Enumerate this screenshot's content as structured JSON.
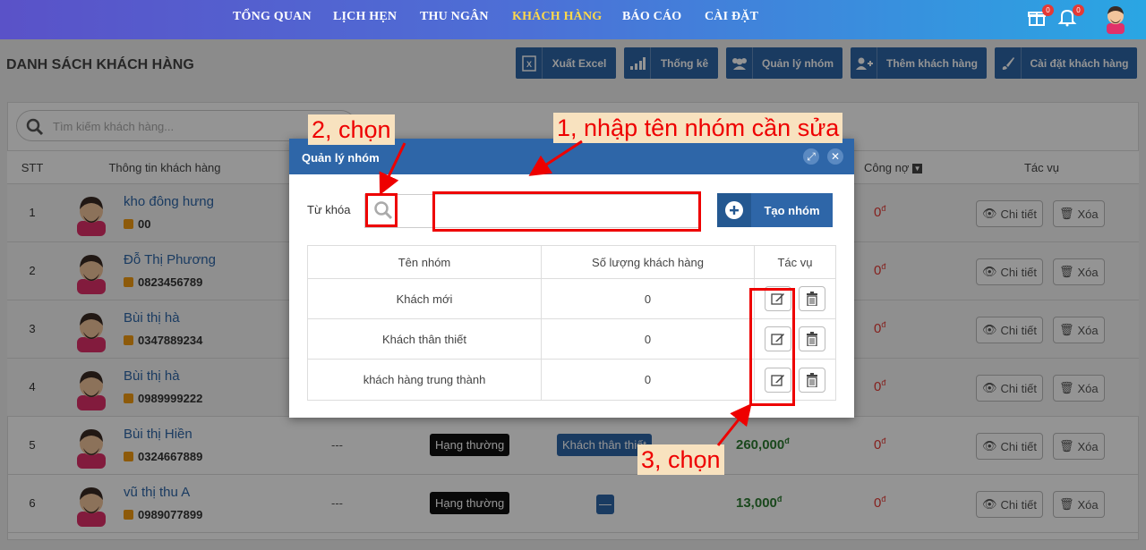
{
  "nav": {
    "items": [
      "TỔNG QUAN",
      "LỊCH HẸN",
      "THU NGÂN",
      "KHÁCH HÀNG",
      "BÁO CÁO",
      "CÀI ĐẶT"
    ],
    "gift_badge": "0",
    "bell_badge": "0"
  },
  "header": {
    "title": "DANH SÁCH KHÁCH HÀNG",
    "buttons": [
      "Xuất Excel",
      "Thống kê",
      "Quản lý nhóm",
      "Thêm khách hàng",
      "Cài đặt khách hàng"
    ]
  },
  "search": {
    "placeholder": "Tìm kiếm khách hàng..."
  },
  "table": {
    "headers": [
      "STT",
      "Thông tin khách hàng",
      "Công nợ",
      "Tác vụ"
    ],
    "detail_label": "Chi tiết",
    "delete_label": "Xóa",
    "rows": [
      {
        "stt": "1",
        "name": "kho đông hưng",
        "phone": "00",
        "debt": "0",
        "debt_unit": "đ"
      },
      {
        "stt": "2",
        "name": "Đỗ Thị Phương",
        "phone": "0823456789",
        "debt": "0",
        "debt_unit": "đ"
      },
      {
        "stt": "3",
        "name": "Bùi thị hà",
        "phone": "0347889234",
        "debt": "0",
        "debt_unit": "đ"
      },
      {
        "stt": "4",
        "name": "Bùi thị hà",
        "phone": "0989999222",
        "debt": "0",
        "debt_unit": "đ"
      },
      {
        "stt": "5",
        "name": "Bùi thị Hiền",
        "phone": "0324667889",
        "debt": "0",
        "debt_unit": "đ",
        "extra": "---",
        "rank": "Hạng thường",
        "group": "Khách thân thiết",
        "spent": "260,000",
        "spent_unit": "đ"
      },
      {
        "stt": "6",
        "name": "vũ thị thu A",
        "phone": "0989077899",
        "debt": "0",
        "debt_unit": "đ",
        "extra": "---",
        "rank": "Hạng thường",
        "group": "—",
        "spent": "13,000",
        "spent_unit": "đ"
      }
    ]
  },
  "modal": {
    "title": "Quản lý nhóm",
    "keyword_label": "Từ khóa",
    "keyword_value": "",
    "create_label": "Tạo nhóm",
    "columns": [
      "Tên nhóm",
      "Số lượng khách hàng",
      "Tác vụ"
    ],
    "groups": [
      {
        "name": "Khách mới",
        "count": "0"
      },
      {
        "name": "Khách thân thiết",
        "count": "0"
      },
      {
        "name": "khách hàng trung thành",
        "count": "0"
      }
    ]
  },
  "annotations": {
    "step1": "1, nhập tên nhóm cần sửa",
    "step2": "2, chọn",
    "step3": "3, chọn"
  },
  "colors": {
    "nav_active": "#ffd94a",
    "primary": "#2e66a8",
    "annotation": "#e00000",
    "debt": "#e53935",
    "money": "#2e7d32"
  }
}
